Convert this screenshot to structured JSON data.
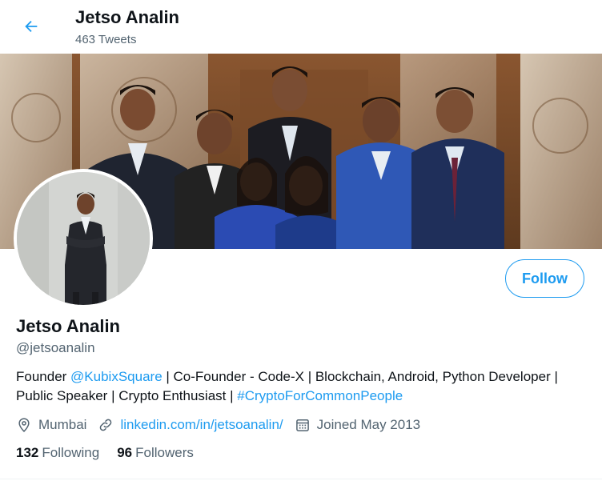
{
  "header": {
    "back_icon": "arrow-left-icon",
    "name": "Jetso Analin",
    "tweet_count": "463 Tweets"
  },
  "profile": {
    "display_name": "Jetso Analin",
    "handle": "@jetsoanalin",
    "follow_label": "Follow",
    "bio": {
      "part1": "Founder ",
      "mention": "@KubixSquare",
      "part2": " | Co-Founder - Code-X | Blockchain, Android, Python Developer | Public Speaker | Crypto Enthusiast | ",
      "hashtag": "#CryptoForCommonPeople"
    },
    "location": "Mumbai",
    "location_icon": "location-pin-icon",
    "website": "linkedin.com/in/jetsoanalin/",
    "website_icon": "link-icon",
    "joined": "Joined May 2013",
    "joined_icon": "calendar-icon",
    "following_count": "132",
    "following_label": "Following",
    "followers_count": "96",
    "followers_label": "Followers"
  },
  "colors": {
    "accent": "#1d9bf0",
    "secondary_text": "#536471",
    "primary_text": "#0f1419"
  }
}
